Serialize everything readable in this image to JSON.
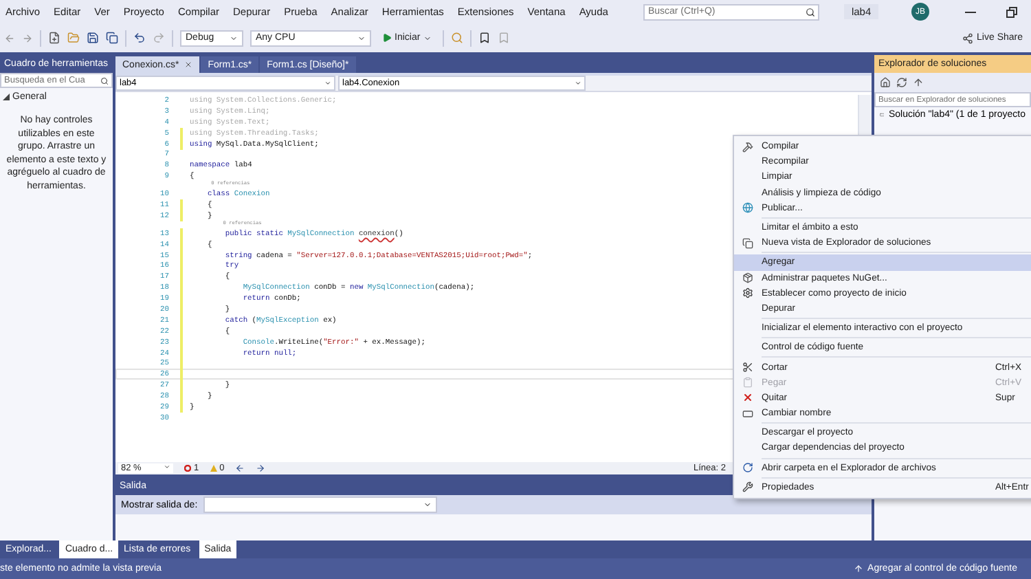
{
  "menu_bar": {
    "items": [
      "Archivo",
      "Editar",
      "Ver",
      "Proyecto",
      "Compilar",
      "Depurar",
      "Prueba",
      "Analizar",
      "Herramientas",
      "Extensiones",
      "Ventana",
      "Ayuda"
    ],
    "search": {
      "placeholder": "Buscar (Ctrl+Q)"
    },
    "solution_name": "lab4",
    "user_initials": "JB"
  },
  "toolbar": {
    "configuration": "Debug",
    "platform": "Any CPU",
    "start": "Iniciar",
    "live_share": "Live Share"
  },
  "toolbox": {
    "title": "Cuadro de herramientas",
    "search": {
      "placeholder": "Busqueda en el Cua"
    },
    "group": {
      "label": "General",
      "expanded": true
    },
    "message": "No hay controles utilizables en este grupo. Arrastre un elemento a este texto y agréguelo al cuadro de herramientas."
  },
  "document_tabs": [
    {
      "label": "Conexion.cs*",
      "selected": true
    },
    {
      "label": "Form1.cs*",
      "selected": false
    },
    {
      "label": "Form1.cs [Diseño]*",
      "selected": false
    }
  ],
  "editor": {
    "navigation": [
      "lab4",
      "lab4.Conexion"
    ],
    "lines": [
      {
        "kind": "code",
        "number": "2",
        "changed": false,
        "current": false,
        "segments": [
          {
            "text": "using System.Collections.Generic;",
            "kind": "dim"
          }
        ]
      },
      {
        "kind": "code",
        "number": "3",
        "changed": false,
        "current": false,
        "segments": [
          {
            "text": "using System.Linq;",
            "kind": "dim"
          }
        ]
      },
      {
        "kind": "code",
        "number": "4",
        "changed": false,
        "current": false,
        "segments": [
          {
            "text": "using System.Text;",
            "kind": "dim"
          }
        ]
      },
      {
        "kind": "code",
        "number": "5",
        "changed": true,
        "current": false,
        "segments": [
          {
            "text": "using System.Threading.Tasks;",
            "kind": "dim"
          }
        ]
      },
      {
        "kind": "code",
        "number": "6",
        "changed": true,
        "current": false,
        "segments": [
          {
            "text": "using",
            "kind": "keyword"
          },
          {
            "text": " MySql.Data.MySqlClient;",
            "kind": "plain"
          }
        ]
      },
      {
        "kind": "code",
        "number": "7",
        "changed": false,
        "current": false
      },
      {
        "kind": "code",
        "number": "8",
        "changed": false,
        "current": false,
        "segments": [
          {
            "text": "namespace",
            "kind": "keyword"
          },
          {
            "text": " lab4",
            "kind": "plain"
          }
        ]
      },
      {
        "kind": "code",
        "number": "9",
        "changed": false,
        "current": false,
        "segments": [
          {
            "text": "{",
            "kind": "plain"
          }
        ]
      },
      {
        "kind": "codelens",
        "text": "    0 referencias"
      },
      {
        "kind": "code",
        "number": "10",
        "changed": false,
        "current": false,
        "segments": [
          {
            "text": "    class",
            "kind": "keyword"
          },
          {
            "text": " Conexion",
            "kind": "type"
          }
        ]
      },
      {
        "kind": "code",
        "number": "11",
        "changed": true,
        "current": false,
        "segments": [
          {
            "text": "    {",
            "kind": "plain"
          }
        ]
      },
      {
        "kind": "code",
        "number": "12",
        "changed": true,
        "current": false,
        "segments": [
          {
            "text": "    }",
            "kind": "plain"
          }
        ]
      },
      {
        "kind": "codelens",
        "text": "        0 referencias"
      },
      {
        "kind": "code",
        "number": "13",
        "changed": true,
        "current": false,
        "segments": [
          {
            "text": "        public static",
            "kind": "keyword"
          },
          {
            "text": " MySqlConnection ",
            "kind": "type"
          },
          {
            "text": "conexion",
            "kind": "squiggle"
          },
          {
            "text": "()",
            "kind": "plain"
          }
        ]
      },
      {
        "kind": "code",
        "number": "14",
        "changed": true,
        "current": false,
        "segments": [
          {
            "text": "    {",
            "kind": "plain"
          }
        ]
      },
      {
        "kind": "code",
        "number": "15",
        "changed": true,
        "current": false,
        "segments": [
          {
            "text": "        string",
            "kind": "keyword"
          },
          {
            "text": " cadena = ",
            "kind": "plain"
          },
          {
            "text": "\"Server=127.0.0.1;Database=VENTAS2015;Uid=root;Pwd=\"",
            "kind": "string"
          },
          {
            "text": ";",
            "kind": "plain"
          }
        ]
      },
      {
        "kind": "code",
        "number": "16",
        "changed": true,
        "current": false,
        "segments": [
          {
            "text": "        try",
            "kind": "keyword"
          }
        ]
      },
      {
        "kind": "code",
        "number": "17",
        "changed": true,
        "current": false,
        "segments": [
          {
            "text": "        {",
            "kind": "plain"
          }
        ]
      },
      {
        "kind": "code",
        "number": "18",
        "changed": true,
        "current": false,
        "segments": [
          {
            "text": "            MySqlConnection",
            "kind": "type"
          },
          {
            "text": " conDb = ",
            "kind": "plain"
          },
          {
            "text": "new",
            "kind": "keyword"
          },
          {
            "text": " MySqlConnection",
            "kind": "type"
          },
          {
            "text": "(cadena);",
            "kind": "plain"
          }
        ]
      },
      {
        "kind": "code",
        "number": "19",
        "changed": true,
        "current": false,
        "segments": [
          {
            "text": "            return",
            "kind": "keyword"
          },
          {
            "text": " conDb;",
            "kind": "plain"
          }
        ]
      },
      {
        "kind": "code",
        "number": "20",
        "changed": true,
        "current": false,
        "segments": [
          {
            "text": "        }",
            "kind": "plain"
          }
        ]
      },
      {
        "kind": "code",
        "number": "21",
        "changed": true,
        "current": false,
        "segments": [
          {
            "text": "        catch",
            "kind": "keyword"
          },
          {
            "text": " (",
            "kind": "plain"
          },
          {
            "text": "MySqlException",
            "kind": "type"
          },
          {
            "text": " ex)",
            "kind": "plain"
          }
        ]
      },
      {
        "kind": "code",
        "number": "22",
        "changed": true,
        "current": false,
        "segments": [
          {
            "text": "        {",
            "kind": "plain"
          }
        ]
      },
      {
        "kind": "code",
        "number": "23",
        "changed": true,
        "current": false,
        "segments": [
          {
            "text": "            Console",
            "kind": "type"
          },
          {
            "text": ".WriteLine(",
            "kind": "plain"
          },
          {
            "text": "\"Error:\"",
            "kind": "string"
          },
          {
            "text": " + ex.Message);",
            "kind": "plain"
          }
        ]
      },
      {
        "kind": "code",
        "number": "24",
        "changed": true,
        "current": false,
        "segments": [
          {
            "text": "            return",
            "kind": "keyword"
          },
          {
            "text": " null;",
            "kind": "keyword"
          }
        ]
      },
      {
        "kind": "code",
        "number": "25",
        "changed": true,
        "current": false
      },
      {
        "kind": "code",
        "number": "26",
        "changed": true,
        "current": true
      },
      {
        "kind": "code",
        "number": "27",
        "changed": true,
        "current": false,
        "segments": [
          {
            "text": "        }",
            "kind": "plain"
          }
        ]
      },
      {
        "kind": "code",
        "number": "28",
        "changed": true,
        "current": false,
        "segments": [
          {
            "text": "    }",
            "kind": "plain"
          }
        ]
      },
      {
        "kind": "code",
        "number": "29",
        "changed": true,
        "current": false,
        "segments": [
          {
            "text": "}",
            "kind": "plain"
          }
        ]
      },
      {
        "kind": "code",
        "number": "30",
        "changed": false,
        "current": false
      }
    ],
    "status": {
      "zoom": "82 %",
      "errors": "1",
      "warnings": "0",
      "position": "Línea: 2"
    }
  },
  "output": {
    "title": "Salida",
    "show_output_from": "Mostrar salida de:"
  },
  "solution_explorer": {
    "title": "Explorador de soluciones",
    "search": {
      "placeholder": "Buscar en Explorador de soluciones"
    },
    "root": "Solución \"lab4\" (1 de 1 proyecto"
  },
  "context_menu": {
    "groups": [
      [
        {
          "label": "Compilar",
          "kind": "build",
          "disabled": false,
          "selected": false
        },
        {
          "label": "Recompilar",
          "kind": "none",
          "disabled": false,
          "selected": false
        },
        {
          "label": "Limpiar",
          "kind": "none",
          "disabled": false,
          "selected": false
        },
        {
          "label": "Análisis y limpieza de código",
          "kind": "none",
          "disabled": false,
          "selected": false
        },
        {
          "label": "Publicar...",
          "kind": "globe",
          "disabled": false,
          "selected": false
        }
      ],
      [
        {
          "label": "Limitar el ámbito a esto",
          "kind": "none",
          "disabled": false,
          "selected": false
        },
        {
          "label": "Nueva vista de Explorador de soluciones",
          "kind": "windows",
          "disabled": false,
          "selected": false
        }
      ],
      [
        {
          "label": "Agregar",
          "kind": "none",
          "disabled": false,
          "selected": true
        },
        {
          "label": "Administrar paquetes NuGet...",
          "kind": "package",
          "disabled": false,
          "selected": false
        },
        {
          "label": "Establecer como proyecto de inicio",
          "kind": "gear",
          "disabled": false,
          "selected": false
        },
        {
          "label": "Depurar",
          "kind": "none",
          "disabled": false,
          "selected": false
        }
      ],
      [
        {
          "label": "Inicializar el elemento interactivo con el proyecto",
          "kind": "none",
          "disabled": false,
          "selected": false
        }
      ],
      [
        {
          "label": "Control de código fuente",
          "kind": "none",
          "disabled": false,
          "selected": false
        }
      ],
      [
        {
          "label": "Cortar",
          "kind": "scissors",
          "shortcut": "Ctrl+X",
          "disabled": false,
          "selected": false
        },
        {
          "label": "Pegar",
          "kind": "clipboard",
          "shortcut": "Ctrl+V",
          "disabled": true,
          "selected": false
        },
        {
          "label": "Quitar",
          "kind": "remove",
          "shortcut": "Supr",
          "disabled": false,
          "selected": false
        },
        {
          "label": "Cambiar nombre",
          "kind": "rename",
          "disabled": false,
          "selected": false
        }
      ],
      [
        {
          "label": "Descargar el proyecto",
          "kind": "none",
          "disabled": false,
          "selected": false
        },
        {
          "label": "Cargar dependencias del proyecto",
          "kind": "none",
          "disabled": false,
          "selected": false
        }
      ],
      [
        {
          "label": "Abrir carpeta en el Explorador de archivos",
          "kind": "refresh",
          "disabled": false,
          "selected": false
        }
      ],
      [
        {
          "label": "Propiedades",
          "kind": "wrench",
          "shortcut": "Alt+Entr",
          "disabled": false,
          "selected": false
        }
      ]
    ]
  },
  "bottom_tabs": {
    "left": [
      {
        "label": "Explorad...",
        "selected": false
      },
      {
        "label": "Cuadro d...",
        "selected": true
      }
    ],
    "center": [
      {
        "label": "Lista de errores",
        "selected": false
      },
      {
        "label": "Salida",
        "selected": true
      }
    ]
  },
  "status_bar": {
    "message": "ste elemento no admite la vista previa",
    "source_control": "Agregar al control de código fuente"
  }
}
